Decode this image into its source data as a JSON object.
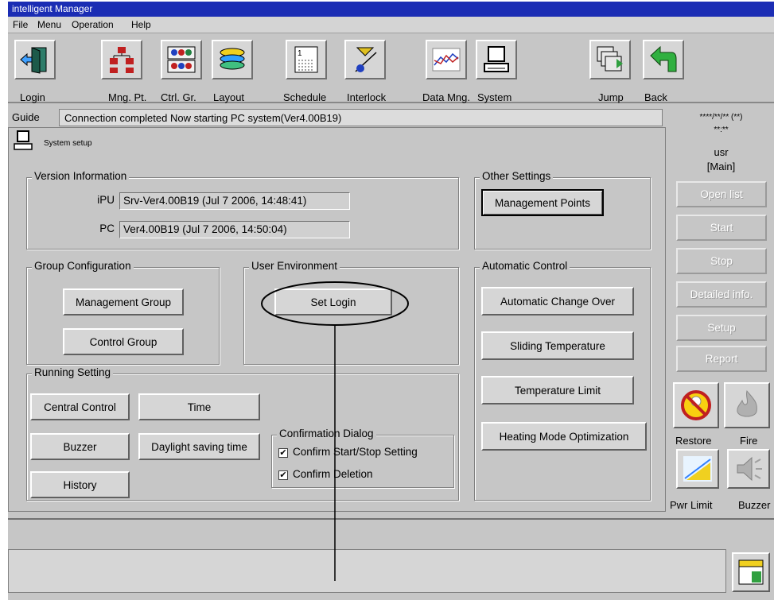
{
  "window": {
    "title": "intelligent Manager"
  },
  "menu": [
    "File",
    "Menu",
    "Operation",
    "Help"
  ],
  "toolbar": {
    "login": "Login",
    "mng_pt": "Mng. Pt.",
    "ctrl_gr": "Ctrl. Gr.",
    "layout": "Layout",
    "schedule": "Schedule",
    "interlock": "Interlock",
    "data_mng": "Data Mng.",
    "system": "System",
    "jump": "Jump",
    "back": "Back"
  },
  "guide": {
    "label": "Guide",
    "message": "Connection completed Now starting PC system(Ver4.00B19)"
  },
  "page": {
    "title": "System setup"
  },
  "version": {
    "legend": "Version Information",
    "ipu_label": "iPU",
    "ipu_value": "Srv-Ver4.00B19 (Jul  7 2006, 14:48:41)",
    "pc_label": "PC",
    "pc_value": "Ver4.00B19 (Jul  7 2006, 14:50:04)"
  },
  "other": {
    "legend": "Other Settings",
    "management_points": "Management Points"
  },
  "group": {
    "legend": "Group Configuration",
    "management_group": "Management Group",
    "control_group": "Control Group"
  },
  "user_env": {
    "legend": "User Environment",
    "set_login": "Set Login"
  },
  "auto": {
    "legend": "Automatic Control",
    "change_over": "Automatic Change Over",
    "sliding": "Sliding Temperature",
    "limit": "Temperature Limit",
    "heating": "Heating Mode Optimization"
  },
  "running": {
    "legend": "Running Setting",
    "central": "Central Control",
    "time": "Time",
    "buzzer": "Buzzer",
    "daylight": "Daylight saving time",
    "history": "History"
  },
  "confirm": {
    "legend": "Confirmation Dialog",
    "start_stop": "Confirm Start/Stop Setting",
    "start_stop_checked": true,
    "deletion": "Confirm Deletion",
    "deletion_checked": true
  },
  "right": {
    "datetime": "****/**/** (**)",
    "clock": "**:**",
    "user": "usr",
    "area": "[Main]",
    "open_list": "Open list",
    "start": "Start",
    "stop": "Stop",
    "detailed": "Detailed info.",
    "setup": "Setup",
    "report": "Report",
    "restore": "Restore",
    "fire": "Fire",
    "pwr_limit": "Pwr Limit",
    "buzzer": "Buzzer"
  }
}
